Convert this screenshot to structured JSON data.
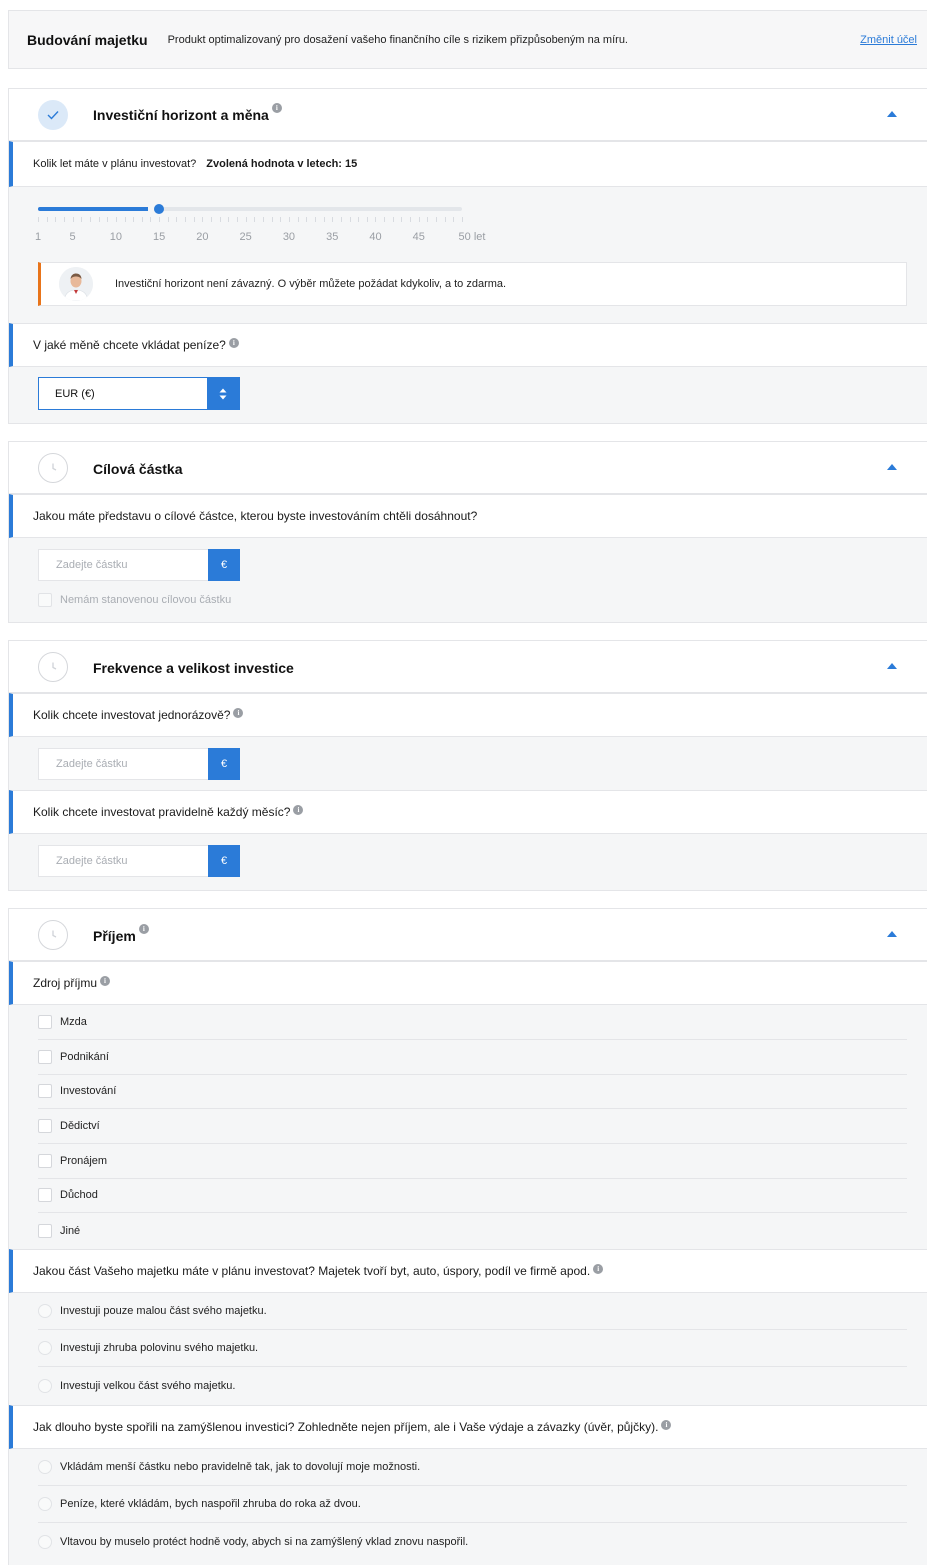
{
  "header": {
    "title": "Budování majetku",
    "description": "Produkt optimalizovaný pro dosažení vašeho finančního cíle s rizikem přizpůsobeným na míru.",
    "change_link": "Změnit účel"
  },
  "info_glyph": "i",
  "horizon": {
    "title": "Investiční horizont a měna",
    "question": "Kolik let máte v plánu investovat?",
    "selected_label": "Zvolená hodnota v letech: 15",
    "slider": {
      "min": 1,
      "max": 50,
      "value": 15
    },
    "tick_labels": [
      "1",
      "5",
      "10",
      "15",
      "20",
      "25",
      "30",
      "35",
      "40",
      "45",
      "50 let"
    ],
    "notice": "Investiční horizont není závazný. O výběr můžete požádat kdykoliv, a to zdarma.",
    "currency_question": "V jaké měně chcete vkládat peníze?",
    "currency_value": "EUR (€)"
  },
  "target": {
    "title": "Cílová částka",
    "question": "Jakou máte představu o cílové částce, kterou byste investováním chtěli dosáhnout?",
    "placeholder": "Zadejte částku",
    "currency_symbol": "€",
    "no_target_label": "Nemám stanovenou cílovou částku"
  },
  "frequency": {
    "title": "Frekvence a velikost investice",
    "lump_question": "Kolik chcete investovat jednorázově?",
    "monthly_question": "Kolik chcete investovat pravidelně každý měsíc?",
    "placeholder": "Zadejte částku",
    "currency_symbol": "€"
  },
  "income": {
    "title": "Příjem",
    "source_question": "Zdroj příjmu",
    "sources": [
      "Mzda",
      "Podnikání",
      "Investování",
      "Dědictví",
      "Pronájem",
      "Důchod",
      "Jiné"
    ],
    "wealth_question": "Jakou část Vašeho majetku máte v plánu investovat? Majetek tvoří byt, auto, úspory, podíl ve firmě apod.",
    "wealth_options": [
      "Investuji pouze malou část svého majetku.",
      "Investuji zhruba polovinu svého majetku.",
      "Investuji velkou část svého majetku."
    ],
    "saving_question": "Jak dlouho byste spořili na zamýšlenou investici? Zohledněte nejen příjem, ale i Vaše výdaje a závazky (úvěr, půjčky).",
    "saving_options": [
      "Vkládám menší částku nebo pravidelně tak, jak to dovolují moje možnosti.",
      "Peníze, které vkládám, bych naspořil zhruba do roka až dvou.",
      "Vltavou by muselo protéct hodně vody, abych si na zamýšlený vklad znovu naspořil."
    ]
  },
  "colors": {
    "accent": "#2b7bd8",
    "notice_bar": "#e8741a"
  }
}
